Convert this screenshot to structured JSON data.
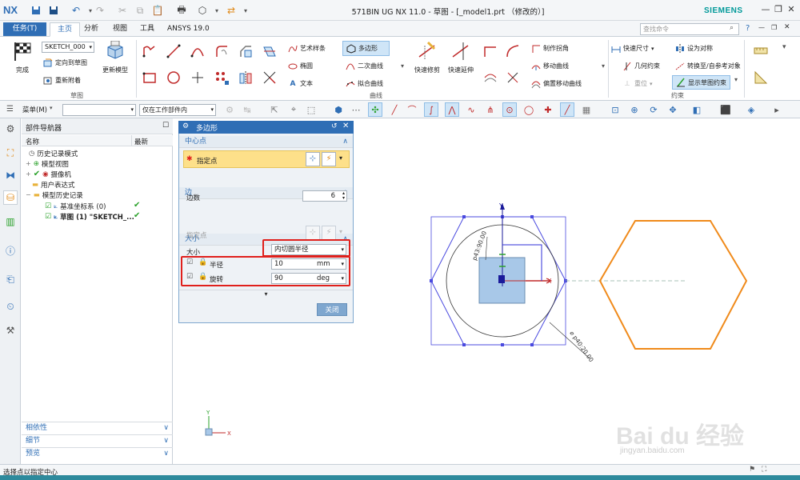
{
  "app": {
    "logo": "NX",
    "window_title": "571BIN UG NX 11.0 - 草图 - [_model1.prt （修改的）]",
    "brand": "SIEMENS"
  },
  "tabs": {
    "task": "任务(T)",
    "items": [
      "主页",
      "分析",
      "视图",
      "工具",
      "ANSYS 19.0"
    ],
    "active": "主页",
    "search_placeholder": "查找命令"
  },
  "ribbon": {
    "sketch_group": {
      "finish_label": "完成",
      "sketch_name": "SKETCH_000",
      "orient_label": "定向到草图",
      "reattach_label": "重新附着",
      "update_model_label": "更新模型",
      "group_label": "草图"
    },
    "curve_group": {
      "art_spline": "艺术样条",
      "polygon": "多边形",
      "ellipse": "椭圆",
      "conic": "二次曲线",
      "text": "文本",
      "fit_curve": "拟合曲线",
      "quick_trim": "快速修剪",
      "quick_extend": "快速延伸",
      "make_corner": "制作拐角",
      "move_curve": "移动曲线",
      "offset_move_curve": "偏置移动曲线",
      "group_label": "曲线"
    },
    "constraint_group": {
      "quick_dimension": "快速尺寸",
      "geometric_constraint": "几何约束",
      "make_symmetric": "设为对称",
      "convert_reference": "转换至/自参考对象",
      "dimension_lock": "重位",
      "show_constraints": "显示草图约束",
      "group_label": "约束"
    }
  },
  "toolbar2": {
    "menu_label": "菜单(M)",
    "filter_value": "",
    "scope_value": "仅在工作部件内"
  },
  "navigator": {
    "title": "部件导航器",
    "col_name": "名称",
    "col_latest": "最新",
    "items": [
      {
        "label": "历史记录模式",
        "indent": 0
      },
      {
        "label": "模型视图",
        "indent": 0
      },
      {
        "label": "摄像机",
        "indent": 0
      },
      {
        "label": "用户表达式",
        "indent": 0
      },
      {
        "label": "模型历史记录",
        "indent": 0
      },
      {
        "label": "基准坐标系 (0)",
        "indent": 1
      },
      {
        "label": "草图 (1) \"SKETCH_...",
        "indent": 1
      }
    ],
    "panels": [
      "相依性",
      "细节",
      "预览"
    ]
  },
  "dialog": {
    "title": "多边形",
    "center_section": "中心点",
    "specify_point": "指定点",
    "edge_section": "边",
    "side_count_label": "边数",
    "side_count": "6",
    "size_section": "大小",
    "size_specify_point": "指定点",
    "size_label": "大小",
    "size_value": "内切圆半径",
    "radius_label": "半径",
    "radius_value": "10",
    "radius_unit": "mm",
    "rotation_label": "旋转",
    "rotation_value": "90",
    "rotation_unit": "deg",
    "close_label": "关闭"
  },
  "graphics": {
    "dim_top": "p43:90.00",
    "dim_bottom": "⌀ p40:20.00",
    "axis_x": "X",
    "axis_y": "Y"
  },
  "status": {
    "prompt": "选择点以指定中心"
  },
  "watermark": {
    "main": "Bai du 经验",
    "sub": "jingyan.baidu.com"
  }
}
